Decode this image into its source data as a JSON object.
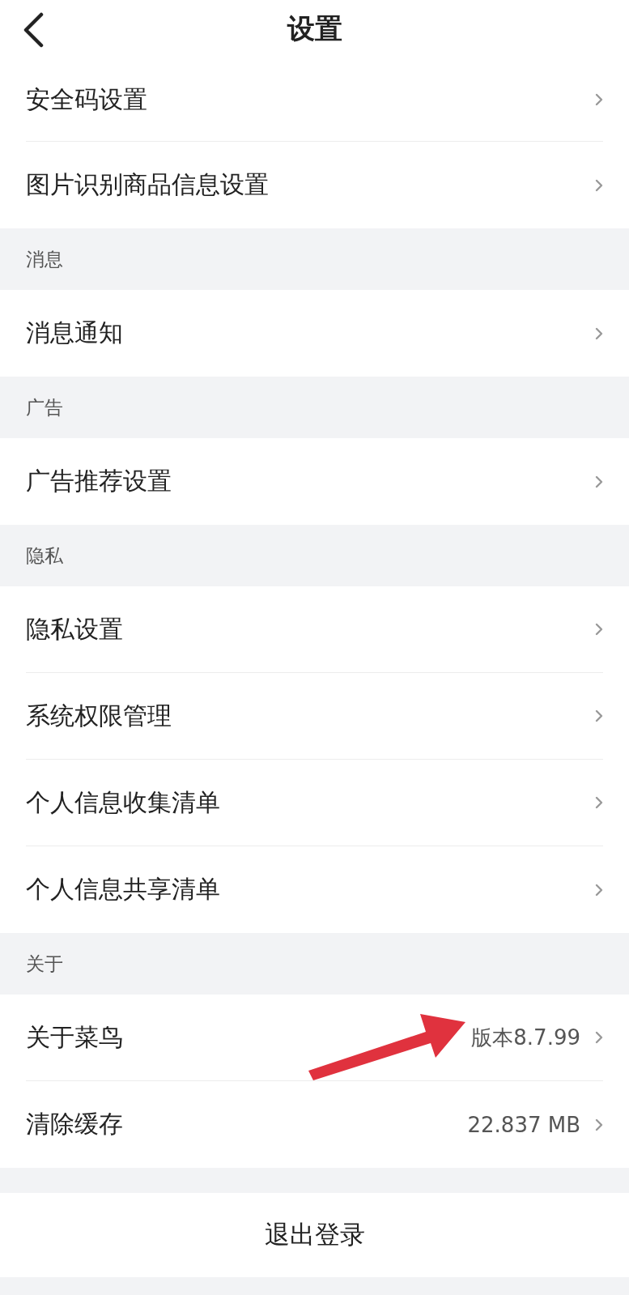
{
  "header": {
    "title": "设置"
  },
  "sections": [
    {
      "items": [
        {
          "label": "安全码设置"
        },
        {
          "label": "图片识别商品信息设置"
        }
      ]
    },
    {
      "label": "消息",
      "items": [
        {
          "label": "消息通知"
        }
      ]
    },
    {
      "label": "广告",
      "items": [
        {
          "label": "广告推荐设置"
        }
      ]
    },
    {
      "label": "隐私",
      "items": [
        {
          "label": "隐私设置"
        },
        {
          "label": "系统权限管理"
        },
        {
          "label": "个人信息收集清单"
        },
        {
          "label": "个人信息共享清单"
        }
      ]
    },
    {
      "label": "关于",
      "items": [
        {
          "label": "关于菜鸟",
          "value": "版本8.7.99"
        },
        {
          "label": "清除缓存",
          "value": "22.837 MB"
        }
      ]
    }
  ],
  "logout": "退出登录"
}
